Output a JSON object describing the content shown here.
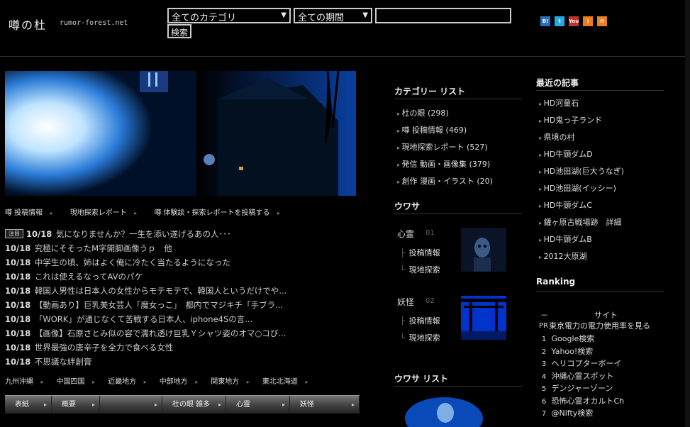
{
  "header": {
    "logo": "噂の杜",
    "domain": "rumor-forest.net",
    "category_select": "全てのカテゴリ",
    "period_select": "全ての期間",
    "search_placeholder": "",
    "search_button": "検索",
    "social": [
      {
        "name": "hatena-bookmark-icon",
        "label": "B!",
        "color": "#2c6ebd"
      },
      {
        "name": "twitter-icon",
        "label": "t",
        "color": "#29a9e1"
      },
      {
        "name": "youtube-icon",
        "label": "You",
        "color": "#c4302b"
      },
      {
        "name": "rss-icon",
        "label": ")",
        "color": "#ee7b1a"
      },
      {
        "name": "mail-icon",
        "label": "✉",
        "color": "#e8822a"
      }
    ]
  },
  "nav": [
    "噂 投稿情報",
    "現地探索レポート",
    "噂 体験談・探索レポートを投稿する"
  ],
  "news": [
    {
      "date": "10/18",
      "tag": "注目",
      "text": "気になりませんか？一生を添い遂げるあの人･･･"
    },
    {
      "date": "10/18",
      "text": "究極にそそったM字開脚画像うｐ　他"
    },
    {
      "date": "10/18",
      "text": "中学生の頃、姉はよく俺に冷たく当たるようになった"
    },
    {
      "date": "10/18",
      "text": "これは使えるなってAVのパケ"
    },
    {
      "date": "10/18",
      "text": "韓国人男性は日本人の女性からモテモテで、韓国人というだけでや..."
    },
    {
      "date": "10/18",
      "text": "【動画あり】巨乳美女芸人「魔女っこ」　都内でマジキチ「手ブラ..."
    },
    {
      "date": "10/18",
      "text": "「WORK」が通じなくて苦戦する日本人、iphone4Sの言..."
    },
    {
      "date": "10/18",
      "text": "【画像】石原さとみ似の容で濡れ透け巨乳Ｙシャツ姿のオマ○コび..."
    },
    {
      "date": "10/18",
      "text": "世界最強の唐辛子を全力で食べる女性"
    },
    {
      "date": "10/18",
      "text": "不思議な絆創膏"
    }
  ],
  "regions": [
    "九州沖縄",
    "中国四国",
    "近畿地方",
    "中部地方",
    "関東地方",
    "東北北海道"
  ],
  "tabs": [
    {
      "label": "表紙"
    },
    {
      "label": "概要"
    },
    {
      "label": ""
    },
    {
      "label": "杜の眼 雑多"
    },
    {
      "label": "心霊"
    },
    {
      "label": "妖怪"
    }
  ],
  "categories": {
    "title": "カテゴリー リスト",
    "items": [
      "杜の眼 (298)",
      "噂 投稿情報 (469)",
      "現地探索レポート (527)",
      "発信 動画・画像集 (379)",
      "創作 漫画・イラスト (20)"
    ]
  },
  "uwasa": {
    "title": "ウワサ",
    "blocks": [
      {
        "title": "心霊",
        "num": "01",
        "links": [
          "投稿情報",
          "現地探索"
        ]
      },
      {
        "title": "妖怪",
        "num": "02",
        "links": [
          "投稿情報",
          "現地探索"
        ]
      }
    ],
    "list_title": "ウワサ リスト"
  },
  "recent": {
    "title": "最近の記事",
    "items": [
      "HD河童石",
      "HD鬼っ子ランド",
      "県境の村",
      "HD牛頸ダムD",
      "HD池田湖(巨大うなぎ)",
      "HD池田湖(イッシー)",
      "HD牛頸ダムC",
      "鑵ヶ原古戦場跡　詳細",
      "HD牛頸ダムB",
      "2012大原湖"
    ]
  },
  "ranking": {
    "title": "Ranking",
    "head_left": "－",
    "head_right": "サイト",
    "pr_label": "PR",
    "pr_text": "東京電力の電力使用率を見る",
    "items": [
      {
        "n": "1",
        "text": "Google検索"
      },
      {
        "n": "2",
        "text": "Yahoo!検索"
      },
      {
        "n": "3",
        "text": "ヘリコプターボーイ"
      },
      {
        "n": "4",
        "text": "沖縄心霊スポット"
      },
      {
        "n": "5",
        "text": "デンジャーゾーン"
      },
      {
        "n": "6",
        "text": "恐怖心霊オカルトCh"
      },
      {
        "n": "7",
        "text": "@Nifty検索"
      }
    ]
  }
}
